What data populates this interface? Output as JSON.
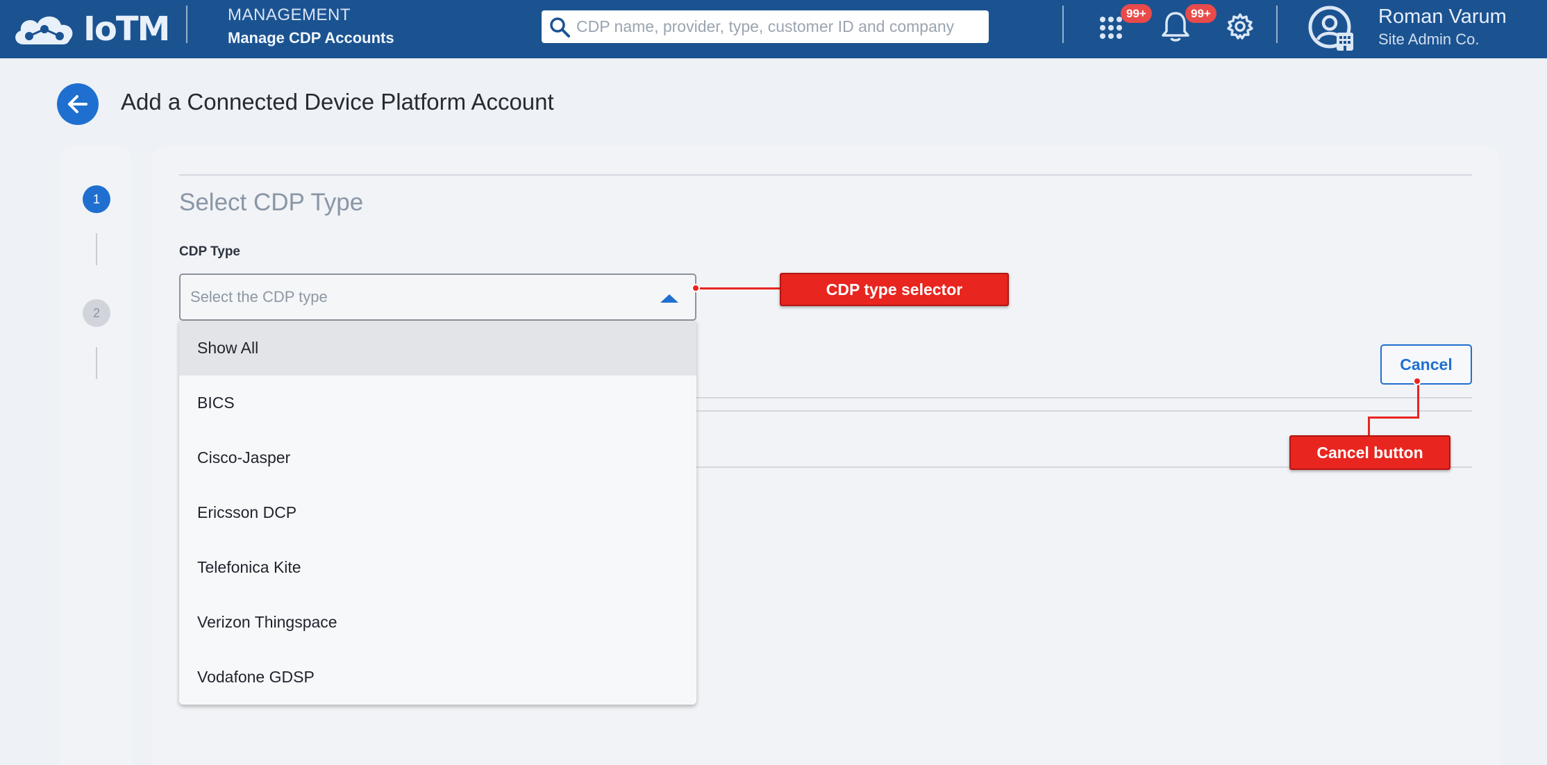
{
  "header": {
    "logo_text": "IoTM",
    "section": "MANAGEMENT",
    "subsection": "Manage CDP Accounts",
    "search_placeholder": "CDP name, provider, type, customer ID and company",
    "apps_badge": "99+",
    "notifications_badge": "99+",
    "user_name": "Roman Varum",
    "user_company": "Site Admin Co."
  },
  "page": {
    "title": "Add a Connected Device Platform Account"
  },
  "steps": [
    {
      "number": "1",
      "state": "active"
    },
    {
      "number": "2",
      "state": "inactive"
    }
  ],
  "form": {
    "section_title": "Select CDP Type",
    "field_label": "CDP Type",
    "select_placeholder": "Select the CDP type",
    "options": [
      "Show All",
      "BICS",
      "Cisco-Jasper",
      "Ericsson DCP",
      "Telefonica Kite",
      "Verizon Thingspace",
      "Vodafone GDSP"
    ],
    "highlighted_option": "Show All",
    "cancel_label": "Cancel"
  },
  "annotations": {
    "selector_callout": "CDP type selector",
    "cancel_callout": "Cancel button"
  },
  "colors": {
    "header_bg": "#1b5391",
    "accent": "#1f6fd0",
    "badge": "#e94a4a",
    "annotation": "#e8251f"
  }
}
